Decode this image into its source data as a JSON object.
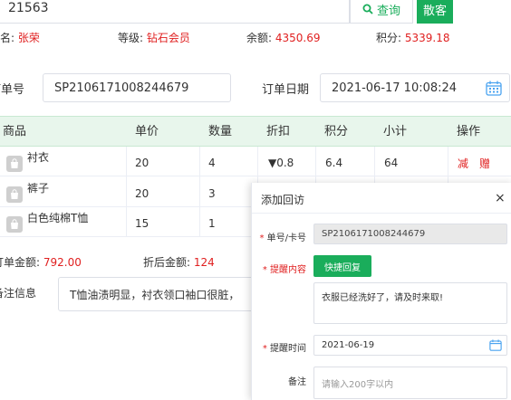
{
  "search": {
    "value": "21563",
    "query_label": "查询",
    "walkin_label": "散客"
  },
  "customer": {
    "name_label": "姓名:",
    "name": "张荣",
    "level_label": "等级:",
    "level": "钻石会员",
    "balance_label": "余额:",
    "balance": "4350.69",
    "points_label": "积分:",
    "points": "5339.18"
  },
  "order": {
    "no_label": "订单号",
    "no": "SP2106171008244679",
    "date_label": "订单日期",
    "date": "2021-06-17 10:08:24"
  },
  "table": {
    "headers": [
      "商品",
      "单价",
      "数量",
      "折扣",
      "积分",
      "小计",
      "操作"
    ],
    "rows": [
      {
        "name": "衬衣",
        "price": "20",
        "qty": "4",
        "discount": "▼0.8",
        "points": "6.4",
        "subtotal": "64"
      },
      {
        "name": "裤子",
        "price": "20",
        "qty": "3"
      },
      {
        "name": "白色纯棉T恤",
        "price": "15",
        "qty": "1"
      }
    ],
    "action_reduce": "减",
    "action_gift": "赠"
  },
  "totals": {
    "order_amount_label": "订单金额:",
    "order_amount": "792.00",
    "after_discount_label": "折后金额:",
    "after_discount": "124"
  },
  "remark": {
    "label": "备注信息",
    "value": "T恤油渍明显，衬衣领口袖口很脏，"
  },
  "dialog": {
    "title": "添加回访",
    "close": "×",
    "card_label": "单号/卡号",
    "card_value": "SP2106171008244679",
    "content_label": "提醒内容",
    "quick_reply": "快捷回复",
    "content_value": "衣服已经洗好了，请及时来取!",
    "time_label": "提醒时间",
    "time_value": "2021-06-19",
    "note_label": "备注",
    "note_placeholder": "请输入200字以内"
  },
  "colors": {
    "accent": "#1aad5b",
    "danger": "#e02020",
    "header_bg": "#e8f6ec"
  }
}
